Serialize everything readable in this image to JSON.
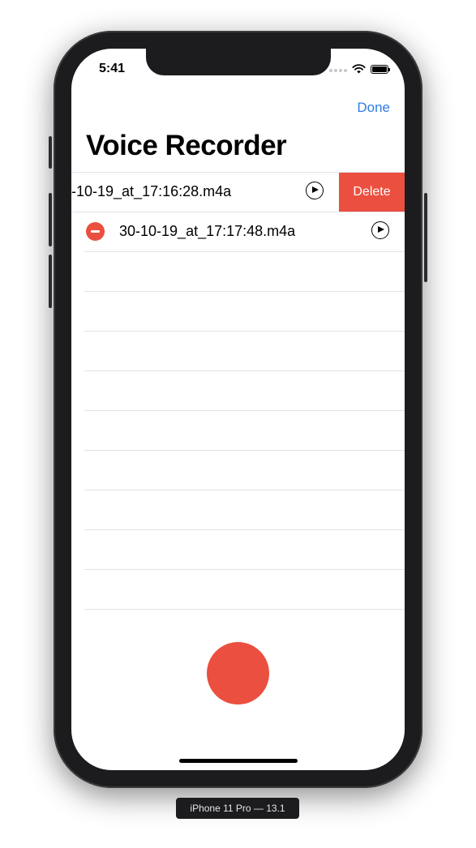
{
  "status_bar": {
    "time": "5:41",
    "icons": [
      "cellular-signal-icon",
      "wifi-icon",
      "battery-icon"
    ]
  },
  "nav": {
    "done_label": "Done",
    "title": "Voice Recorder"
  },
  "recordings": [
    {
      "name": "-10-19_at_17:16:28.m4a",
      "state": "swiped-to-delete",
      "delete_label": "Delete"
    },
    {
      "name": "30-10-19_at_17:17:48.m4a",
      "state": "editing"
    }
  ],
  "record_button": {
    "icon": "record-icon"
  },
  "device_label": "iPhone 11 Pro — 13.1",
  "colors": {
    "accent": "#2f7de1",
    "destructive": "#eb4f3f",
    "separator": "#e3e3e6"
  }
}
